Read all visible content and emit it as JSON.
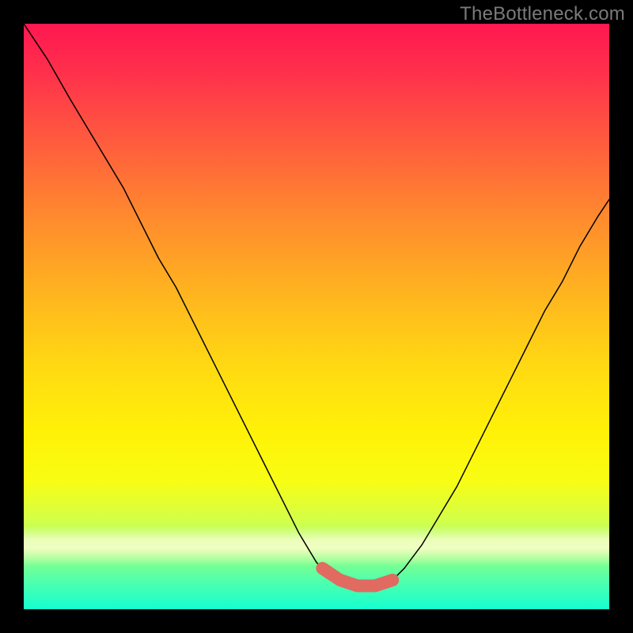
{
  "watermark": "TheBottleneck.com",
  "colors": {
    "background": "#000000",
    "curve_thin": "#000000",
    "curve_thick": "#e16a61"
  },
  "chart_data": {
    "type": "line",
    "title": "",
    "xlabel": "",
    "ylabel": "",
    "xlim": [
      0,
      100
    ],
    "ylim": [
      0,
      100
    ],
    "series": [
      {
        "name": "bottleneck-curve",
        "x": [
          0,
          4,
          8,
          11,
          14,
          17,
          20,
          23,
          26,
          29,
          32,
          35,
          38,
          41,
          44,
          47,
          50,
          53,
          55,
          57,
          60,
          63,
          65,
          68,
          71,
          74,
          77,
          80,
          83,
          86,
          89,
          92,
          95,
          98,
          100
        ],
        "y": [
          100,
          94,
          87,
          82,
          77,
          72,
          66,
          60,
          55,
          49,
          43,
          37,
          31,
          25,
          19,
          13,
          8,
          5,
          4,
          4,
          4,
          5,
          7,
          11,
          16,
          21,
          27,
          33,
          39,
          45,
          51,
          56,
          62,
          67,
          70
        ]
      }
    ],
    "highlight": {
      "name": "trough-highlight",
      "x": [
        51,
        54,
        57,
        60,
        63
      ],
      "y": [
        7,
        5,
        4,
        4,
        5
      ]
    }
  }
}
